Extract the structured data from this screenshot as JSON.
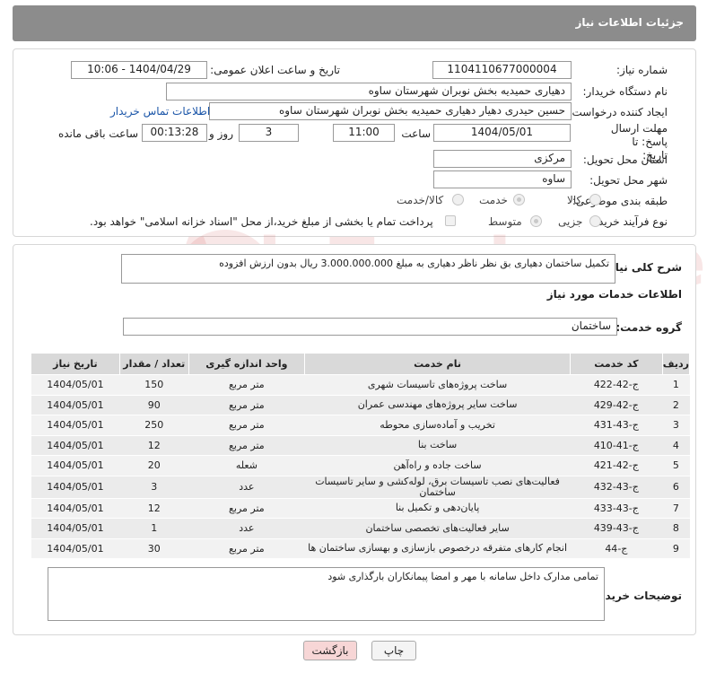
{
  "header": {
    "title": "جزئیات اطلاعات نیاز"
  },
  "form": {
    "need_number_label": "شماره نیاز:",
    "need_number": "1104110677000004",
    "announce_label": "تاریخ و ساعت اعلان عمومی:",
    "announce_value": "1404/04/29 - 10:06",
    "buyer_org_label": "نام دستگاه خریدار:",
    "buyer_org": "دهیاری حمیدیه بخش نوبران شهرستان ساوه",
    "requester_label": "ایجاد کننده درخواست:",
    "requester": "حسین حیدری دهیار دهیاری حمیدیه بخش نوبران شهرستان ساوه",
    "contact_link": "اطلاعات تماس خریدار",
    "deadline_label": "مهلت ارسال پاسخ: تا تاریخ:",
    "deadline_date": "1404/05/01",
    "time_label": "ساعت",
    "deadline_time": "11:00",
    "days_value": "3",
    "days_label": "روز و",
    "remaining_time": "00:13:28",
    "remaining_label": "ساعت باقی مانده",
    "province_label": "استان محل تحویل:",
    "province": "مرکزی",
    "city_label": "شهر محل تحویل:",
    "city": "ساوه",
    "category_label": "طبقه بندی موضوعی:",
    "category_options": [
      "کالا",
      "خدمت",
      "کالا/خدمت"
    ],
    "process_label": "نوع فرآیند خرید :",
    "process_options": [
      "جزیی",
      "متوسط"
    ],
    "payment_text": "پرداخت تمام یا بخشی از مبلغ خرید،از محل \"اسناد خزانه اسلامی\" خواهد بود."
  },
  "need": {
    "summary_label": "شرح کلی نیاز:",
    "summary_value": "تکمیل ساختمان دهیاری بق نظر ناظر دهیاری به مبلغ 3.000.000.000 ریال بدون ارزش افزوده",
    "services_title": "اطلاعات خدمات مورد نیاز",
    "group_label": "گروه خدمت:",
    "group_value": "ساختمان"
  },
  "table": {
    "headers": [
      "ردیف",
      "کد خدمت",
      "نام خدمت",
      "واحد اندازه گیری",
      "تعداد / مقدار",
      "تاریخ نیاز"
    ],
    "rows": [
      [
        "1",
        "ج-42-422",
        "ساخت پروژه‌های تاسیسات شهری",
        "متر مربع",
        "150",
        "1404/05/01"
      ],
      [
        "2",
        "ج-42-429",
        "ساخت سایر پروژه‌های مهندسی عمران",
        "متر مربع",
        "90",
        "1404/05/01"
      ],
      [
        "3",
        "ج-43-431",
        "تخریب و آماده‌سازی محوطه",
        "متر مربع",
        "250",
        "1404/05/01"
      ],
      [
        "4",
        "ج-41-410",
        "ساخت بنا",
        "متر مربع",
        "12",
        "1404/05/01"
      ],
      [
        "5",
        "ج-42-421",
        "ساخت جاده و راه‌آهن",
        "شعله",
        "20",
        "1404/05/01"
      ],
      [
        "6",
        "ج-43-432",
        "فعالیت‌های نصب تاسیسات برق، لوله‌کشی و سایر تاسیسات ساختمان",
        "عدد",
        "3",
        "1404/05/01"
      ],
      [
        "7",
        "ج-43-433",
        "پایان‌دهی و تکمیل بنا",
        "متر مربع",
        "12",
        "1404/05/01"
      ],
      [
        "8",
        "ج-43-439",
        "سایر فعالیت‌های تخصصی ساختمان",
        "عدد",
        "1",
        "1404/05/01"
      ],
      [
        "9",
        "ج-44",
        "انجام کارهای متفرقه درخصوص بازسازی و بهسازی ساختمان ها",
        "متر مربع",
        "30",
        "1404/05/01"
      ]
    ]
  },
  "buyer_notes": {
    "label": "توضیحات خریدار:",
    "value": "تمامی مدارک داخل سامانه با مهر و امضا پیمانکاران بارگذاری شود"
  },
  "buttons": {
    "print": "چاپ",
    "back": "بازگشت"
  },
  "watermark": "AriaTender.net",
  "colors": {
    "header_bg": "#8c8c8c",
    "link": "#1a55a8",
    "back_btn_bg": "#f7d6d6"
  }
}
